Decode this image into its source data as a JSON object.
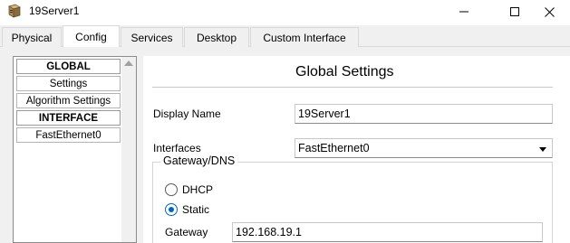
{
  "window": {
    "title": "19Server1",
    "icon": "server-icon",
    "controls": [
      "minimize-icon",
      "maximize-icon",
      "close-icon"
    ]
  },
  "tabs": [
    {
      "label": "Physical",
      "active": false
    },
    {
      "label": "Config",
      "active": true
    },
    {
      "label": "Services",
      "active": false
    },
    {
      "label": "Desktop",
      "active": false
    },
    {
      "label": "Custom Interface",
      "active": false
    }
  ],
  "sidebar": {
    "items": [
      {
        "label": "GLOBAL",
        "type": "header"
      },
      {
        "label": "Settings",
        "type": "item"
      },
      {
        "label": "Algorithm Settings",
        "type": "item"
      },
      {
        "label": "INTERFACE",
        "type": "header"
      },
      {
        "label": "FastEthernet0",
        "type": "item"
      }
    ]
  },
  "panel": {
    "title": "Global Settings",
    "display_name_label": "Display Name",
    "display_name_value": "19Server1",
    "interfaces_label": "Interfaces",
    "interfaces_value": "FastEthernet0",
    "gateway_dns": {
      "legend": "Gateway/DNS",
      "dhcp_label": "DHCP",
      "static_label": "Static",
      "selected": "Static",
      "gateway_label": "Gateway",
      "gateway_value": "192.168.19.1"
    }
  },
  "colors": {
    "accent": "#0067c0",
    "tabbar": "#f0f0f0",
    "panel": "#ffffff"
  }
}
